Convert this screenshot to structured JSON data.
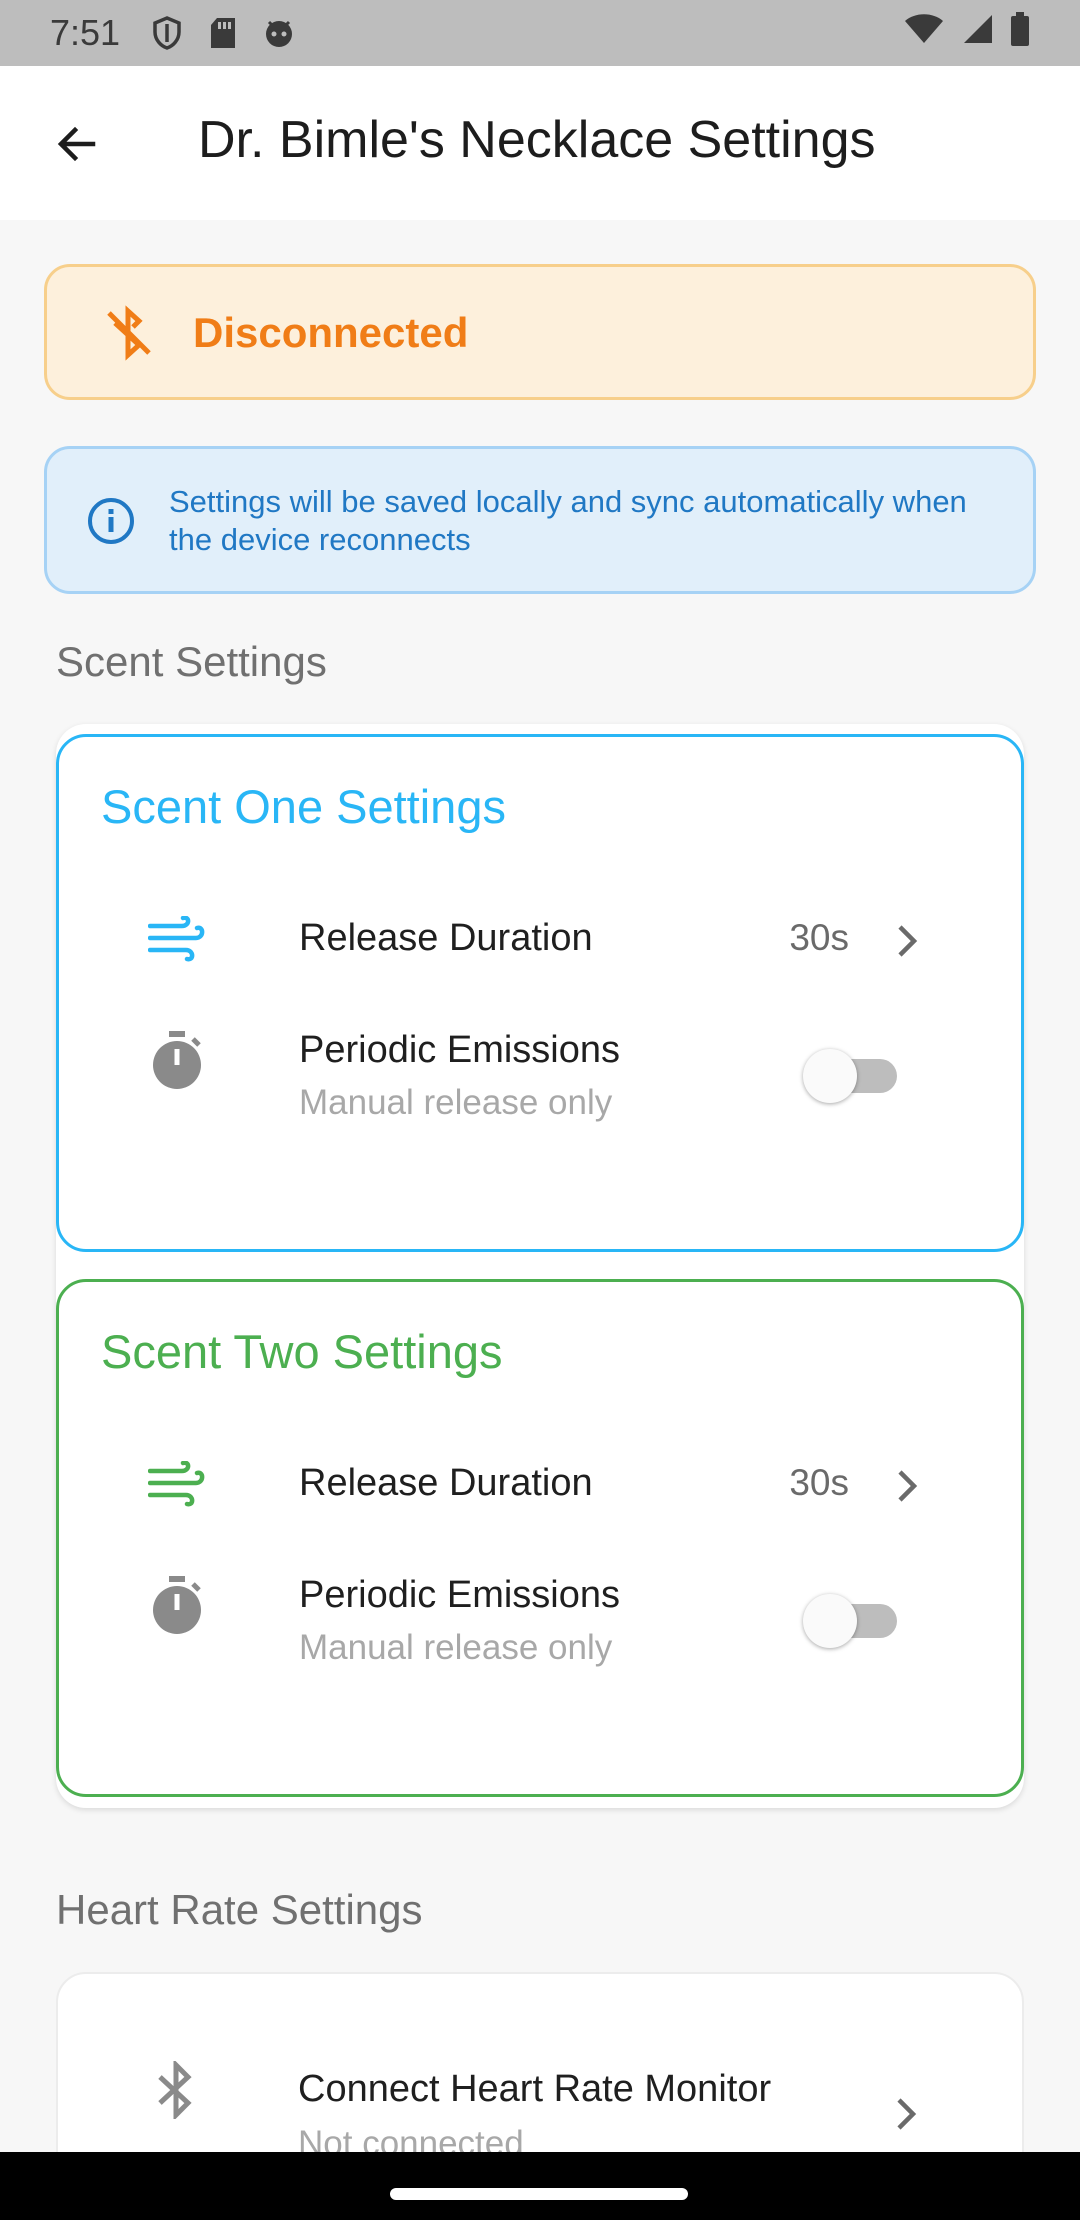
{
  "status_bar": {
    "time": "7:51"
  },
  "app_bar": {
    "title": "Dr. Bimle's Necklace Settings"
  },
  "connection_banner": {
    "status": "Disconnected",
    "color": "#f07d17"
  },
  "info_banner": {
    "text": "Settings will be saved locally and sync automatically when the device reconnects"
  },
  "sections": {
    "scent": "Scent Settings",
    "heart_rate": "Heart Rate Settings"
  },
  "scent_one": {
    "title": "Scent One Settings",
    "accent": "#29b6f6",
    "release_label": "Release Duration",
    "release_value": "30s",
    "periodic_label": "Periodic Emissions",
    "periodic_sub": "Manual release only",
    "periodic_enabled": false
  },
  "scent_two": {
    "title": "Scent Two Settings",
    "accent": "#4caf50",
    "release_label": "Release Duration",
    "release_value": "30s",
    "periodic_label": "Periodic Emissions",
    "periodic_sub": "Manual release only",
    "periodic_enabled": false
  },
  "heart_rate": {
    "connect_label": "Connect Heart Rate Monitor",
    "connect_sub": "Not connected"
  }
}
